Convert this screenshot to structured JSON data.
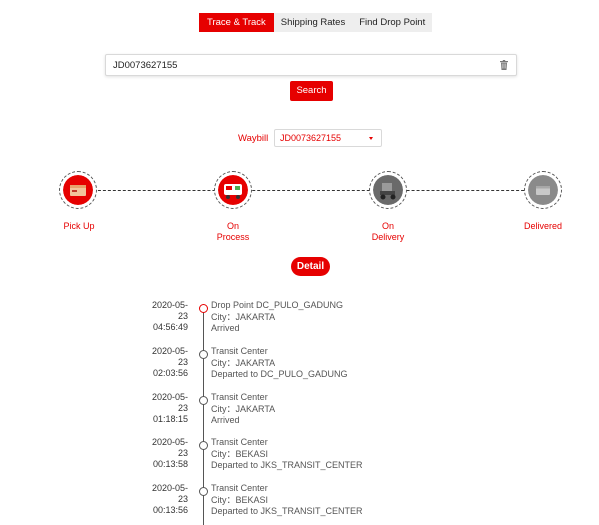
{
  "tabs": [
    {
      "label": "Trace & Track",
      "active": true
    },
    {
      "label": "Shipping Rates",
      "active": false
    },
    {
      "label": "Find Drop Point",
      "active": false
    }
  ],
  "search": {
    "value": "JD0073627155",
    "button_label": "Search"
  },
  "waybill": {
    "label": "Waybill",
    "selected": "JD0073627155"
  },
  "steps": [
    {
      "label_line1": "Pick Up",
      "label_line2": "",
      "icon": "pickup-icon"
    },
    {
      "label_line1": "On",
      "label_line2": "Process",
      "icon": "process-icon"
    },
    {
      "label_line1": "On",
      "label_line2": "Delivery",
      "icon": "delivery-icon"
    },
    {
      "label_line1": "Delivered",
      "label_line2": "",
      "icon": "delivered-icon"
    }
  ],
  "detail_label": "Detail",
  "events": [
    {
      "date1": "2020-05-",
      "date2": "23",
      "time": "04:56:49",
      "title": "Drop Point DC_PULO_GADUNG",
      "city": "City：JAKARTA",
      "status": "Arrived"
    },
    {
      "date1": "2020-05-",
      "date2": "23",
      "time": "02:03:56",
      "title": "Transit Center",
      "city": "City：JAKARTA",
      "status": "Departed to DC_PULO_GADUNG"
    },
    {
      "date1": "2020-05-",
      "date2": "23",
      "time": "01:18:15",
      "title": "Transit Center",
      "city": "City：JAKARTA",
      "status": "Arrived"
    },
    {
      "date1": "2020-05-",
      "date2": "23",
      "time": "00:13:58",
      "title": "Transit Center",
      "city": "City：BEKASI",
      "status": "Departed to JKS_TRANSIT_CENTER"
    },
    {
      "date1": "2020-05-",
      "date2": "23",
      "time": "00:13:56",
      "title": "Transit Center",
      "city": "City：BEKASI",
      "status": "Departed to JKS_TRANSIT_CENTER"
    }
  ],
  "colors": {
    "accent": "#e60000",
    "tab_bg": "#eeeeee"
  }
}
